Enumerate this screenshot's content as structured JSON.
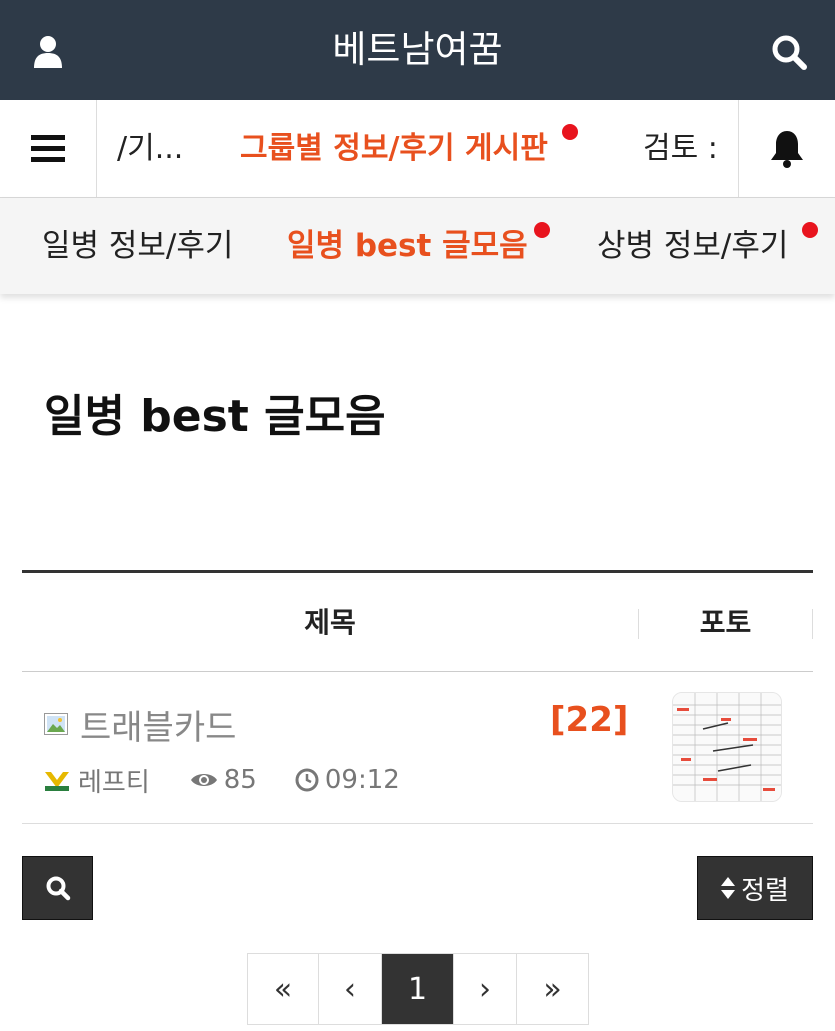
{
  "header": {
    "title": "베트남여꿈",
    "user_icon": "user-icon",
    "search_icon": "search-icon",
    "background": "#2e3a48"
  },
  "category_nav": {
    "menu_icon": "menu-icon",
    "bell_icon": "bell-icon",
    "tabs": [
      {
        "label": "/기..."
      },
      {
        "label": "그룹별 정보/후기 게시판",
        "active": true,
        "new": true
      },
      {
        "label": "검토 :"
      }
    ]
  },
  "sub_nav": {
    "tabs": [
      {
        "label": "일병 정보/후기"
      },
      {
        "label": "일병 best 글모음",
        "active": true,
        "new": true
      },
      {
        "label": "상병 정보/후기",
        "new": true
      }
    ]
  },
  "page_title": "일병 best 글모음",
  "board": {
    "col_title": "제목",
    "col_photo": "포토",
    "posts": [
      {
        "title": "트래블카드",
        "comments": "[22]",
        "author": "레프티",
        "views": "85",
        "time": "09:12",
        "has_image": true
      }
    ]
  },
  "buttons": {
    "search_icon": "search-icon",
    "sort_label": "정렬"
  },
  "pagination": {
    "first": "«",
    "prev": "‹",
    "current": "1",
    "next": "›",
    "last": "»"
  },
  "colors": {
    "accent": "#e8501e",
    "new_dot": "#e8141e",
    "dark": "#333333"
  }
}
